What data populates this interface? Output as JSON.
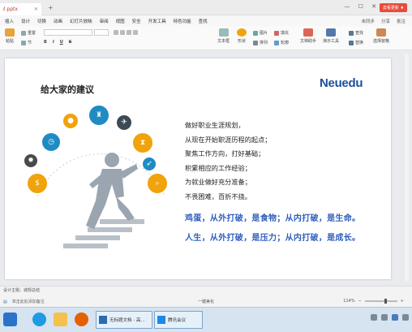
{
  "window": {
    "tab_title": "ℓ.pptx",
    "sync_label": "去看更新 ♦",
    "controls": "— ☐ ✕"
  },
  "menu": {
    "items": [
      "插入",
      "设计",
      "切换",
      "动画",
      "幻灯片放映",
      "审阅",
      "视图",
      "安全",
      "开发工具",
      "特色功能",
      "查找"
    ],
    "right": [
      "未同步",
      "分享",
      "批注"
    ]
  },
  "ribbon": {
    "paste": "粘贴",
    "reset": "重置",
    "section": "节",
    "bold": "B",
    "italic": "I",
    "underline": "U",
    "strike": "S",
    "textbox": "文本框",
    "shape": "形状",
    "arrange": "排列",
    "picture": "图片",
    "fill": "填充",
    "outline": "轮廓",
    "text_assistant": "文档助手",
    "presentation_tools": "演示工具",
    "find": "查找",
    "replace": "替换",
    "select_pane": "选择窗格"
  },
  "slide": {
    "title": "给大家的建议",
    "logo": "Neuedu",
    "bullets": [
      "做好职业生涯规划，",
      "从现在开始职涯历程的起点；",
      "聚焦工作方向，打好基础；",
      "积累相应的工作经验；",
      "为就业做好充分准备；",
      "不畏困难，百折不挠。"
    ],
    "slogans": [
      "鸡蛋，从外打破，是食物；从内打破，是生命。",
      "人生，从外打破，是压力；从内打破，是成长。"
    ],
    "icons": [
      {
        "name": "gear-icon",
        "color": "#4a4a4a",
        "glyph": "✹"
      },
      {
        "name": "stopwatch-icon",
        "color": "#1e8bc3",
        "glyph": "◷"
      },
      {
        "name": "apple-icon",
        "color": "#f0a30a",
        "glyph": "●"
      },
      {
        "name": "trophy-icon",
        "color": "#1e8bc3",
        "glyph": "♜"
      },
      {
        "name": "airplane-icon",
        "color": "#3c4a55",
        "glyph": "✈"
      },
      {
        "name": "hourglass-icon",
        "color": "#f0a30a",
        "glyph": "⧗"
      },
      {
        "name": "money-bag-icon",
        "color": "#f0a30a",
        "glyph": "$"
      },
      {
        "name": "rocket-icon",
        "color": "#1e8bc3",
        "glyph": "➶"
      },
      {
        "name": "search-icon",
        "color": "#f0a30a",
        "glyph": "⌕"
      }
    ]
  },
  "status": {
    "theme": "设计主题：城规总结",
    "notes": "单击此处添加备注",
    "zoom": "114%",
    "center": "一键美化"
  },
  "taskbar": {
    "win1": "无标题文档 - 高...",
    "win2": "腾讯会议"
  }
}
